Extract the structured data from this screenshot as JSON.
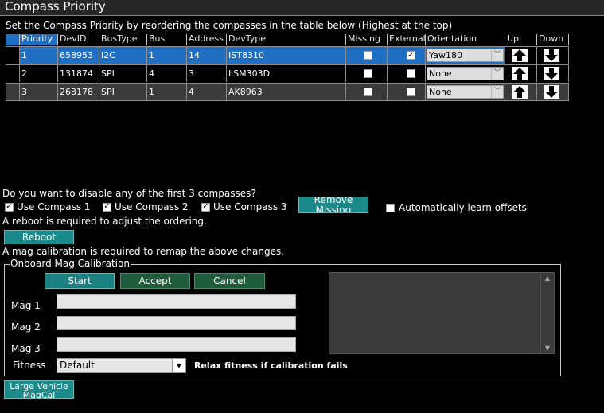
{
  "title": "Compass Priority",
  "instructions": "Set the Compass Priority by reordering the compasses in the table below (Highest at the top)",
  "table": {
    "headers": [
      "Priority",
      "DevID",
      "BusType",
      "Bus",
      "Address",
      "DevType",
      "Missing",
      "External",
      "Orientation",
      "Up",
      "Down"
    ],
    "rows": [
      {
        "priority": "1",
        "devid": "658953",
        "bustype": "I2C",
        "bus": "1",
        "address": "14",
        "devtype": "IST8310",
        "missing": false,
        "external": true,
        "orientation": "Yaw180",
        "selected": true
      },
      {
        "priority": "2",
        "devid": "131874",
        "bustype": "SPI",
        "bus": "4",
        "address": "3",
        "devtype": "LSM303D",
        "missing": false,
        "external": false,
        "orientation": "None",
        "selected": false
      },
      {
        "priority": "3",
        "devid": "263178",
        "bustype": "SPI",
        "bus": "1",
        "address": "4",
        "devtype": "AK8963",
        "missing": false,
        "external": false,
        "orientation": "None",
        "selected": false
      }
    ]
  },
  "disable_question": "Do you want to disable any of the first 3 compasses?",
  "use_compass": [
    {
      "label": "Use Compass 1",
      "checked": true
    },
    {
      "label": "Use Compass 2",
      "checked": true
    },
    {
      "label": "Use Compass 3",
      "checked": true
    }
  ],
  "remove_missing_label": "Remove Missing",
  "auto_learn_label": "Automatically learn offsets",
  "auto_learn_checked": false,
  "reboot_note": "A reboot is required to adjust the ordering.",
  "reboot_label": "Reboot",
  "remap_note": "A mag calibration is required to remap the above changes.",
  "calibration": {
    "group_title": "Onboard Mag Calibration",
    "start_label": "Start",
    "accept_label": "Accept",
    "cancel_label": "Cancel",
    "mag_labels": [
      "Mag 1",
      "Mag 2",
      "Mag 3"
    ],
    "fitness_label": "Fitness",
    "fitness_value": "Default",
    "relax_label": "Relax fitness if calibration fails"
  },
  "large_vehicle_label": "Large Vehicle MagCal",
  "colors": {
    "selected_row": "#1f6fc5",
    "teal_button": "#1b8a8a",
    "green_button": "#1e5c3c"
  }
}
